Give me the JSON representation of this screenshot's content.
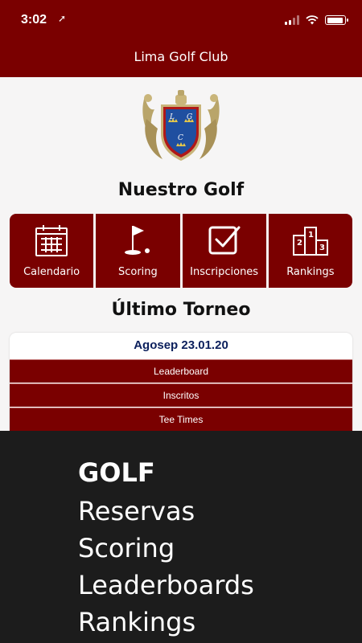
{
  "status_bar": {
    "time": "3:02",
    "location_glyph": "➚"
  },
  "header": {
    "title": "Lima Golf Club"
  },
  "crest": {
    "letters": [
      "L",
      "G",
      "C"
    ]
  },
  "sections": {
    "our_golf": "Nuestro Golf",
    "last_tournament": "Último Torneo"
  },
  "menu": [
    {
      "label": "Calendario",
      "icon": "calendar-icon"
    },
    {
      "label": "Scoring",
      "icon": "golf-flag-icon"
    },
    {
      "label": "Inscripciones",
      "icon": "checkbox-icon"
    },
    {
      "label": "Rankings",
      "icon": "podium-icon"
    }
  ],
  "tournament": {
    "name": "Agosep 23.01.20",
    "rows": [
      "Leaderboard",
      "Inscritos",
      "Tee Times"
    ]
  },
  "promo": {
    "lines": [
      "GOLF",
      "Reservas",
      "Scoring",
      "Leaderboards",
      "Rankings"
    ]
  },
  "colors": {
    "brand": "#7a0000",
    "date_text": "#0b1f5c",
    "overlay_bg": "#1c1c1c"
  }
}
